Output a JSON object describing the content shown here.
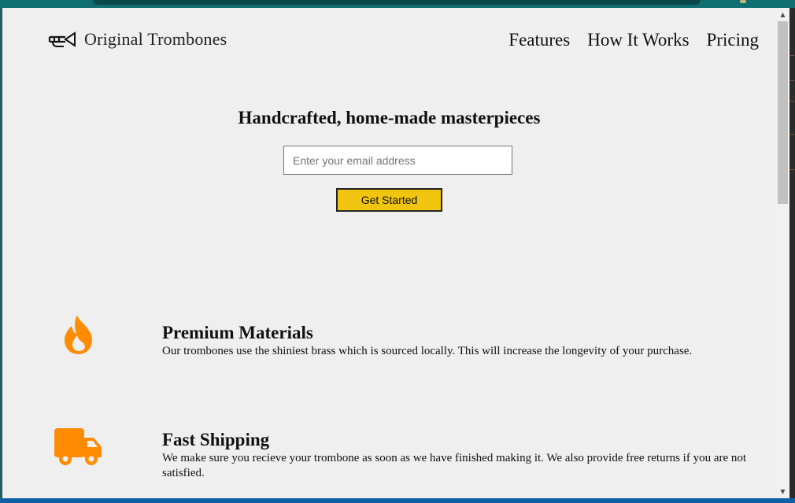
{
  "header": {
    "brand": "Original Trombones",
    "nav": [
      {
        "label": "Features"
      },
      {
        "label": "How It Works"
      },
      {
        "label": "Pricing"
      }
    ]
  },
  "hero": {
    "title": "Handcrafted, home-made masterpieces",
    "email_placeholder": "Enter your email address",
    "cta_label": "Get Started"
  },
  "features": [
    {
      "icon": "fire-icon",
      "title": "Premium Materials",
      "description": "Our trombones use the shiniest brass which is sourced locally. This will increase the longevity of your purchase."
    },
    {
      "icon": "truck-icon",
      "title": "Fast Shipping",
      "description": "We make sure you recieve your trombone as soon as we have finished making it. We also provide free returns if you are not satisfied."
    }
  ],
  "colors": {
    "accent": "#f1c40f",
    "icon": "#ff8c00",
    "page_background": "#efefef"
  }
}
